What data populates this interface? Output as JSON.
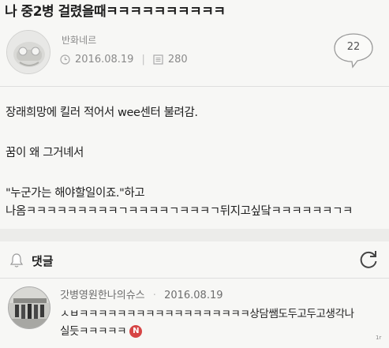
{
  "post": {
    "title": "나 중2병 걸렸을때ㅋㅋㅋㅋㅋㅋㅋㅋㅋㅋ",
    "author": "반화네르",
    "date": "2016.08.19",
    "views": "280",
    "comment_count": "22",
    "body": [
      "장래희망에 킬러 적어서 wee센터 불려감.",
      "꿈이 왜 그거녜서",
      "\"누군가는 해야할일이죠.\"하고",
      "나옴ㅋㅋㅋㅋㅋㅋㅋㅋㅋㄱㅋㅋㅋㅋㄱㅋㅋㅋㄱ뒤지고싶닼ㅋㅋㅋㅋㅋㅋㄱㅋ"
    ]
  },
  "comments": {
    "label": "댓글",
    "items": [
      {
        "author": "갓병영원한나의슈스",
        "date": "2016.08.19",
        "line1": "ㅅㅂㅋㅋㅋㅋㅋㅋㅋㅋㅋㅋㅋㅋㅋㅋㅋㅋㅋㅋ상담쌤도두고두고생각나",
        "line2": "실듯ㅋㅋㅋㅋㅋ",
        "badge": "N"
      }
    ]
  },
  "icons": {
    "date": "clock-icon",
    "views": "views-icon",
    "comments": "speech-bubble-icon",
    "bell": "bell-icon",
    "refresh": "refresh-icon"
  },
  "colors": {
    "background": "#f7f7f5",
    "new_badge": "#d64545",
    "meta_text": "#8a8a8a"
  },
  "watermark": "1r"
}
